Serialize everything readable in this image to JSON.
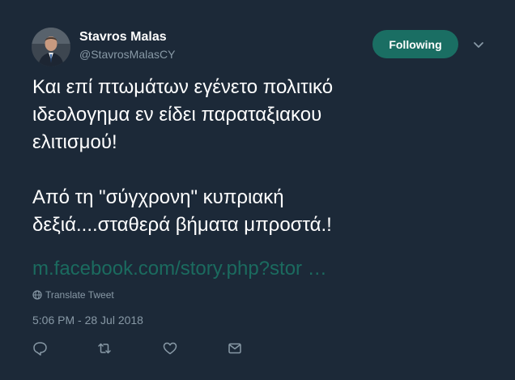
{
  "user": {
    "display_name": "Stavros Malas",
    "handle": "@StavrosMalasCY"
  },
  "follow_button": {
    "label": "Following"
  },
  "tweet": {
    "paragraph_1": [
      "Και επί πτωμάτων εγένετο πολιτικό",
      "ιδεολογημα εν είδει παραταξιακου",
      "ελιτισμού!"
    ],
    "paragraph_2": [
      "Από τη \"σύγχρονη\" κυπριακή",
      "δεξιά....σταθερά βήματα μπροστά.!"
    ],
    "link_text": "m.facebook.com/story.php?stor …",
    "translate_label": "Translate Tweet",
    "timestamp": "5:06 PM - 28 Jul 2018"
  },
  "actions": [
    "reply-icon",
    "retweet-icon",
    "like-icon",
    "direct-message-icon"
  ],
  "colors": {
    "background": "#1c2938",
    "accent": "#1a6e63",
    "link": "#1b6b5f",
    "muted": "#8899a6"
  }
}
